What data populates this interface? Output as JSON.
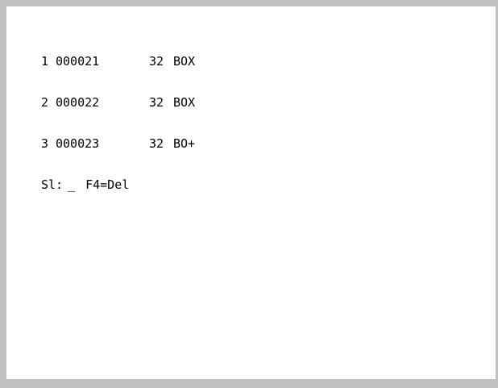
{
  "rows": [
    {
      "num": "1",
      "id": "000021",
      "qty": "32",
      "unit": "BOX"
    },
    {
      "num": "2",
      "id": "000022",
      "qty": "32",
      "unit": "BOX"
    },
    {
      "num": "3",
      "id": "000023",
      "qty": "32",
      "unit": "BO+"
    }
  ],
  "prompt": {
    "label": "Sl:",
    "input_value": "_",
    "key_hint": "F4=Del"
  },
  "colors": {
    "frame": "#c0c0c0",
    "screen_bg": "#ffffff",
    "text": "#000000"
  }
}
